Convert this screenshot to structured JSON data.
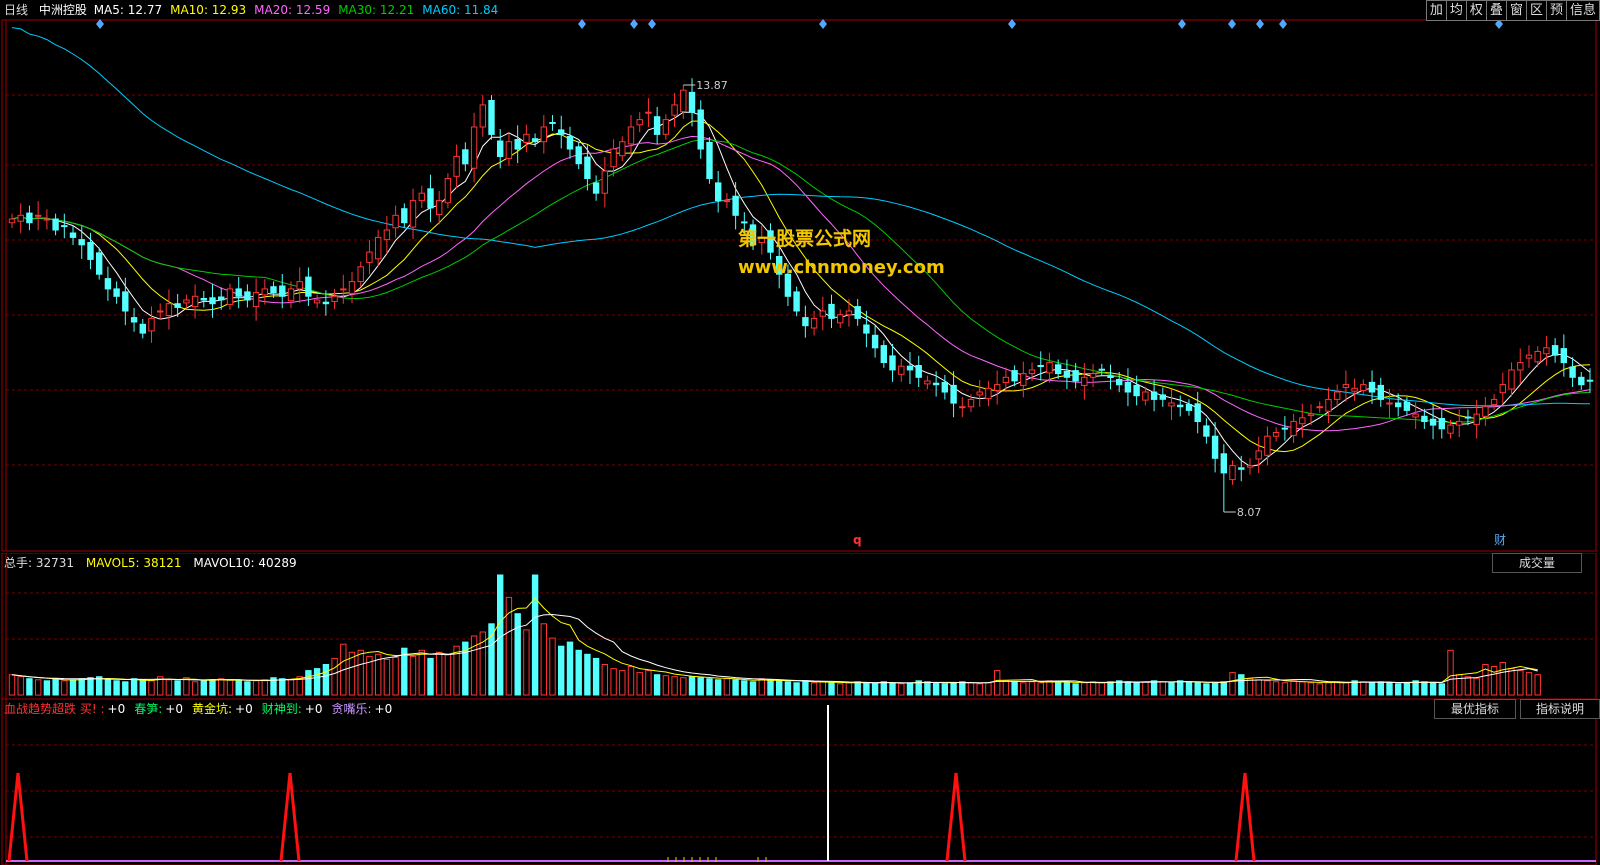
{
  "header": {
    "period": "日线",
    "stock_name": "中洲控股",
    "ma": [
      {
        "label": "MA5:",
        "value": "12.77",
        "color": "#ffffff"
      },
      {
        "label": "MA10:",
        "value": "12.93",
        "color": "#ffff00"
      },
      {
        "label": "MA20:",
        "value": "12.59",
        "color": "#ff66ff"
      },
      {
        "label": "MA30:",
        "value": "12.21",
        "color": "#00cc00"
      },
      {
        "label": "MA60:",
        "value": "11.84",
        "color": "#00ccff"
      }
    ]
  },
  "toolbar": {
    "buttons": [
      "加",
      "均",
      "权",
      "叠",
      "窗",
      "区",
      "预",
      "信息"
    ]
  },
  "price_panel": {
    "high_label": "13.87",
    "low_label": "8.07",
    "marker_q": "q",
    "marker_cai": "财",
    "watermark_title": "第一股票公式网",
    "watermark_url": "www.chnmoney.com"
  },
  "volume_panel": {
    "label": "总手:",
    "value": "32731",
    "mavol5_label": "MAVOL5:",
    "mavol5_value": "38121",
    "mavol10_label": "MAVOL10:",
    "mavol10_value": "40289",
    "button": "成交量"
  },
  "indicator_panel": {
    "name": "血战趋势超跌 买!",
    "items": [
      {
        "label": ":",
        "value": "+0",
        "color": "#ff3333"
      },
      {
        "label": "春笋:",
        "value": "+0",
        "color": "#00ff66"
      },
      {
        "label": "黄金坑:",
        "value": "+0",
        "color": "#ffff00"
      },
      {
        "label": "财神到:",
        "value": "+0",
        "color": "#00ff66"
      },
      {
        "label": "贪嘴乐:",
        "value": "+0",
        "color": "#cc99ff"
      }
    ],
    "buttons": [
      "最优指标",
      "指标说明"
    ]
  },
  "colors": {
    "up": "#ff3333",
    "down": "#54ffff",
    "grid": "#7a0000",
    "border": "#a00000"
  },
  "chart_data": {
    "type": "candlestick",
    "price_range": [
      8.07,
      13.87
    ],
    "closes": [
      12.05,
      12.1,
      12.0,
      12.1,
      12.05,
      11.9,
      11.95,
      11.8,
      11.7,
      11.5,
      11.3,
      11.1,
      11.0,
      10.8,
      10.65,
      10.5,
      10.7,
      10.8,
      10.9,
      10.85,
      10.95,
      11.0,
      10.95,
      10.9,
      10.95,
      11.1,
      11.0,
      10.95,
      11.05,
      11.1,
      11.05,
      11.0,
      11.1,
      11.2,
      11.0,
      10.95,
      10.9,
      11.0,
      11.1,
      11.2,
      11.4,
      11.6,
      11.8,
      11.9,
      12.1,
      12.0,
      12.3,
      12.4,
      12.2,
      12.3,
      12.6,
      12.9,
      12.8,
      13.3,
      13.6,
      13.2,
      12.9,
      13.1,
      13.0,
      13.2,
      13.1,
      13.3,
      13.35,
      13.2,
      13.0,
      12.8,
      12.6,
      12.4,
      12.7,
      13.0,
      13.1,
      13.3,
      13.4,
      13.5,
      13.2,
      13.4,
      13.6,
      13.8,
      13.5,
      13.0,
      12.6,
      12.3,
      12.3,
      12.1,
      12.0,
      11.7,
      11.8,
      11.6,
      11.3,
      11.0,
      10.8,
      10.6,
      10.7,
      10.8,
      10.7,
      10.75,
      10.8,
      10.7,
      10.5,
      10.3,
      10.1,
      10.0,
      10.05,
      10.0,
      9.9,
      9.85,
      9.8,
      9.7,
      9.55,
      9.5,
      9.6,
      9.7,
      9.75,
      9.8,
      9.9,
      9.85,
      9.95,
      10.0,
      10.05,
      10.1,
      9.95,
      9.9,
      9.85,
      9.9,
      9.95,
      10.0,
      9.9,
      9.8,
      9.7,
      9.65,
      9.7,
      9.6,
      9.6,
      9.55,
      9.5,
      9.45,
      9.3,
      9.1,
      8.8,
      8.6,
      8.7,
      8.65,
      8.7,
      8.9,
      9.1,
      9.15,
      9.2,
      9.3,
      9.35,
      9.4,
      9.5,
      9.6,
      9.7,
      9.8,
      9.75,
      9.8,
      9.7,
      9.6,
      9.55,
      9.5,
      9.45,
      9.4,
      9.3,
      9.25,
      9.2,
      9.25,
      9.3,
      9.35,
      9.4,
      9.5,
      9.6,
      9.8,
      10.0,
      10.1,
      10.2,
      10.25,
      10.3,
      10.2,
      10.1,
      9.9,
      9.8,
      9.85
    ],
    "ma_series": [
      "MA5",
      "MA10",
      "MA20",
      "MA30",
      "MA60"
    ],
    "volume_range": [
      0,
      120000
    ],
    "volumes": [
      20000,
      18000,
      16000,
      15000,
      14000,
      16000,
      14000,
      15000,
      16000,
      17000,
      18000,
      15000,
      14000,
      13000,
      16000,
      15000,
      14000,
      18000,
      15000,
      14000,
      17000,
      13000,
      14000,
      15000,
      16000,
      15000,
      14000,
      13000,
      14000,
      15000,
      17000,
      16000,
      15000,
      18000,
      24000,
      26000,
      30000,
      36000,
      50000,
      42000,
      44000,
      38000,
      40000,
      35000,
      37000,
      46000,
      38000,
      44000,
      36000,
      42000,
      40000,
      48000,
      52000,
      58000,
      62000,
      70000,
      118000,
      96000,
      80000,
      64000,
      118000,
      70000,
      56000,
      48000,
      52000,
      44000,
      40000,
      36000,
      30000,
      26000,
      24000,
      28000,
      22000,
      24000,
      20000,
      19000,
      18000,
      17000,
      18000,
      17000,
      16000,
      15000,
      16000,
      15000,
      14000,
      13000,
      16000,
      15000,
      14000,
      13000,
      12000,
      14000,
      12000,
      13000,
      12000,
      11000,
      12000,
      13000,
      12000,
      11000,
      13000,
      12000,
      11000,
      12000,
      14000,
      13000,
      12000,
      11000,
      12000,
      13000,
      12000,
      11000,
      12000,
      24000,
      14000,
      13000,
      12000,
      13000,
      12000,
      14000,
      13000,
      12000,
      11000,
      12000,
      13000,
      12000,
      13000,
      14000,
      13000,
      12000,
      13000,
      14000,
      13000,
      12000,
      14000,
      13000,
      12000,
      11000,
      12000,
      13000,
      22000,
      20000,
      16000,
      15000,
      14000,
      13000,
      12000,
      14000,
      13000,
      12000,
      11000,
      12000,
      13000,
      12000,
      14000,
      13000,
      12000,
      13000,
      12000,
      11000,
      12000,
      14000,
      13000,
      12000,
      11000,
      44000,
      20000,
      18000,
      16000,
      30000,
      28000,
      32000,
      26000,
      24000,
      22000,
      20000
    ],
    "indicator_peaks_x": [
      18,
      290,
      956,
      1245
    ]
  }
}
